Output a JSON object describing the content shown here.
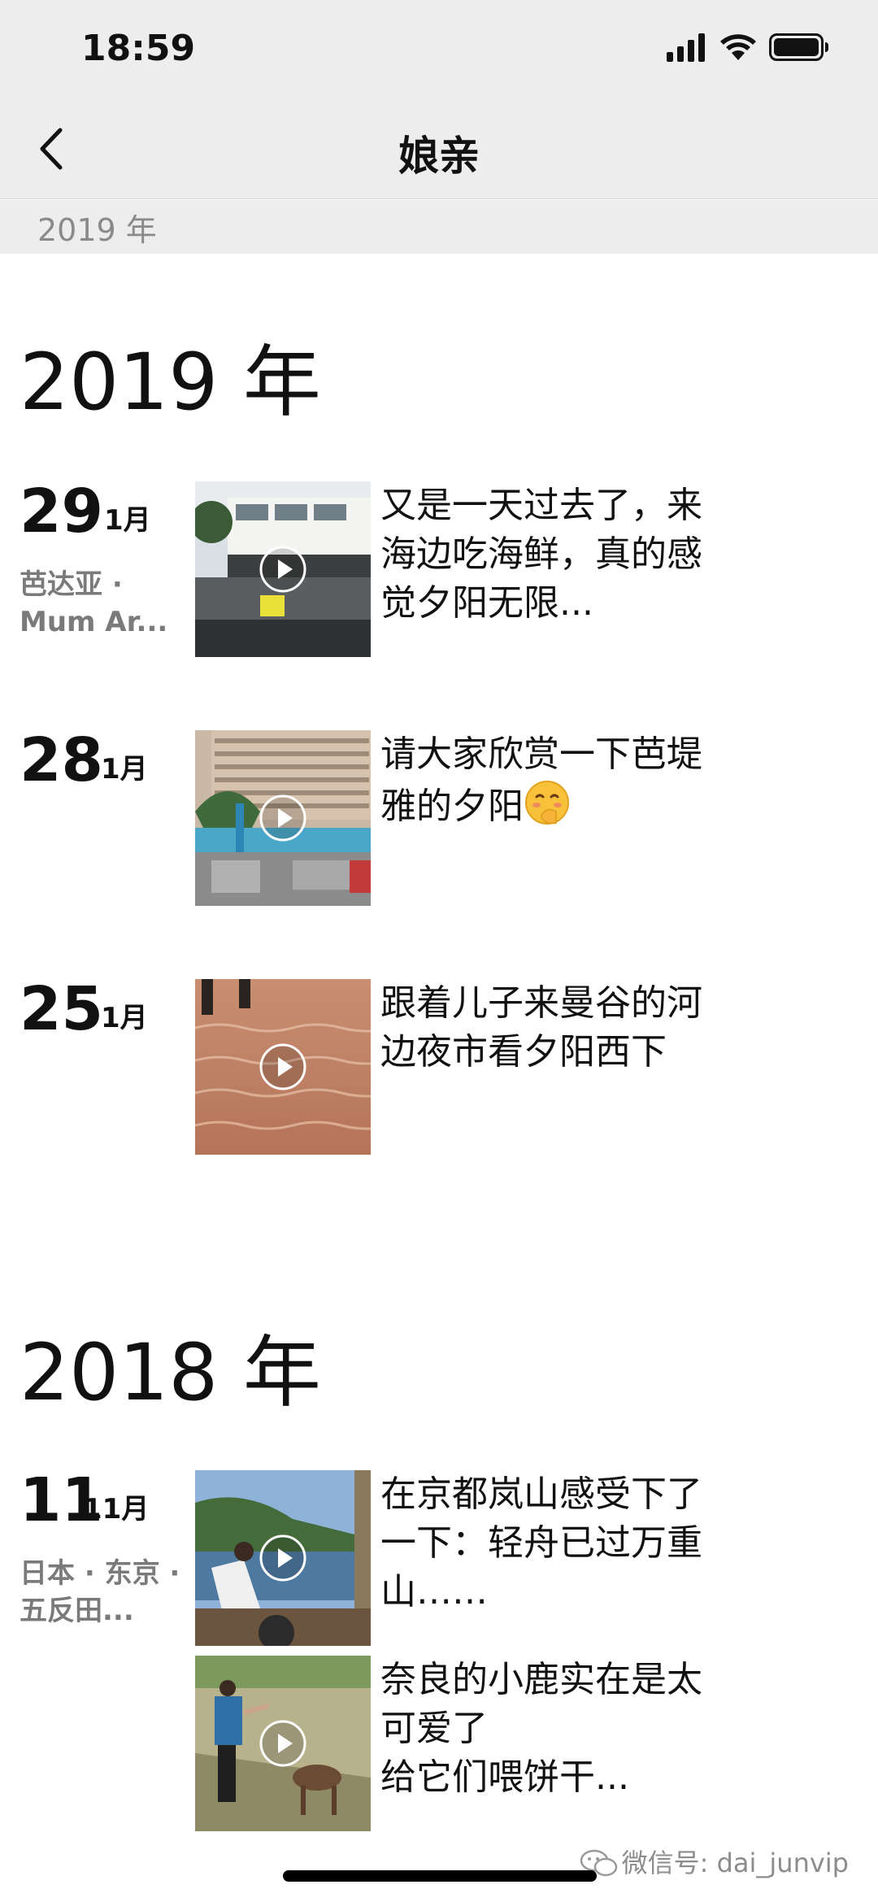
{
  "status_bar": {
    "time": "18:59",
    "icons": [
      "signal-icon",
      "wifi-icon",
      "battery-icon"
    ]
  },
  "nav": {
    "back_icon": "chevron-left-icon",
    "title": "娘亲"
  },
  "sticky_year": "2019 年",
  "sections": [
    {
      "year": "2019 年",
      "entries": [
        {
          "day": "29",
          "month": "1月",
          "location": "芭达亚 · Mum Ar...",
          "posts": [
            {
              "thumb": "video",
              "text": "又是一天过去了，来海边吃海鲜，真的感觉夕阳无限..."
            }
          ]
        },
        {
          "day": "28",
          "month": "1月",
          "location": "",
          "posts": [
            {
              "thumb": "video",
              "text": "请大家欣赏一下芭堤雅的夕阳"
            }
          ]
        },
        {
          "day": "25",
          "month": "1月",
          "location": "",
          "posts": [
            {
              "thumb": "video",
              "text": "跟着儿子来曼谷的河边夜市看夕阳西下"
            }
          ]
        }
      ]
    },
    {
      "year": "2018 年",
      "entries": [
        {
          "day": "11",
          "month": "11月",
          "location": "日本 · 东京 · 五反田...",
          "posts": [
            {
              "thumb": "video",
              "text": "在京都岚山感受下了一下：轻舟已过万重山……"
            },
            {
              "thumb": "video",
              "text": "奈良的小鹿实在是太可爱了\n给它们喂饼干..."
            }
          ]
        }
      ]
    }
  ],
  "watermark": "微信号: dai_junvip",
  "colors": {
    "header_bg": "#ededed",
    "secondary_text": "#7a7a7a"
  }
}
